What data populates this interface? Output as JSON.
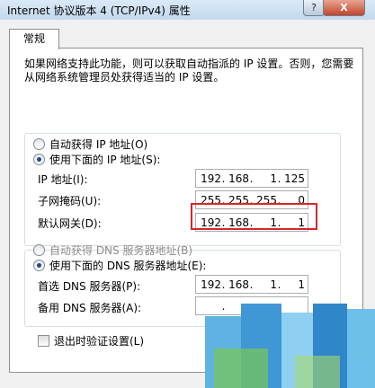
{
  "window": {
    "title": "Internet 协议版本 4 (TCP/IPv4) 属性",
    "help_label": "?",
    "close_label": "X"
  },
  "tab": {
    "label": "常规"
  },
  "description": "如果网络支持此功能，则可以获取自动指派的 IP 设置。否则，您需要从网络系统管理员处获得适当的 IP 设置。",
  "ip_section": {
    "auto_option": "自动获得 IP 地址(O)",
    "manual_option": "使用下面的 IP 地址(S):",
    "selected": "manual",
    "fields": [
      {
        "label": "IP 地址(I):",
        "octets": [
          "192",
          "168",
          "1",
          "125"
        ]
      },
      {
        "label": "子网掩码(U):",
        "octets": [
          "255",
          "255",
          "255",
          "0"
        ]
      },
      {
        "label": "默认网关(D):",
        "octets": [
          "192",
          "168",
          "1",
          "1"
        ]
      }
    ]
  },
  "dns_section": {
    "auto_option": "自动获得 DNS 服务器地址(B)",
    "manual_option": "使用下面的 DNS 服务器地址(E):",
    "selected": "manual",
    "fields": [
      {
        "label": "首选 DNS 服务器(P):",
        "octets": [
          "192",
          "168",
          "1",
          "1"
        ]
      },
      {
        "label": "备用 DNS 服务器(A):",
        "octets": [
          "",
          "",
          "",
          ""
        ]
      }
    ]
  },
  "validate_checkbox": {
    "label": "退出时验证设置(L)",
    "checked": false
  },
  "colors": {
    "highlight": "#d7262b",
    "window_bg": "#f0f0f0"
  }
}
